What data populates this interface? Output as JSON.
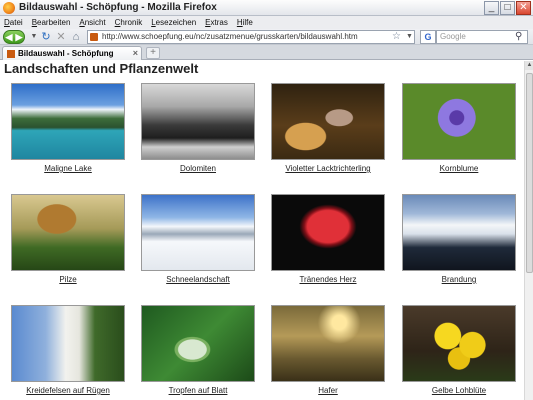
{
  "window": {
    "title": "Bildauswahl - Schöpfung - Mozilla Firefox",
    "controls": [
      "_",
      "□",
      "✕"
    ]
  },
  "menu": [
    "Datei",
    "Bearbeiten",
    "Ansicht",
    "Chronik",
    "Lesezeichen",
    "Extras",
    "Hilfe"
  ],
  "nav": {
    "url": "http://www.schoepfung.eu/nc/zusatzmenue/grusskarten/bildauswahl.htm",
    "search_placeholder": "Google",
    "search_engine_icon": "G"
  },
  "tab": {
    "label": "Bildauswahl - Schöpfung",
    "close": "×",
    "new_tab": "+"
  },
  "page": {
    "title": "Landschaften und Pflanzenwelt",
    "images": [
      {
        "caption": "Maligne Lake",
        "icon": "lake-landscape"
      },
      {
        "caption": "Dolomiten",
        "icon": "mountains"
      },
      {
        "caption": "Violetter Lacktrichterling",
        "icon": "mushroom"
      },
      {
        "caption": "Kornblume",
        "icon": "cornflower"
      },
      {
        "caption": "Pilze",
        "icon": "mushroom"
      },
      {
        "caption": "Schneelandschaft",
        "icon": "snow-mountains"
      },
      {
        "caption": "Tränendes Herz",
        "icon": "bleeding-heart-flower"
      },
      {
        "caption": "Brandung",
        "icon": "surf-waves"
      },
      {
        "caption": "Kreidefelsen auf Rügen",
        "icon": "chalk-cliffs"
      },
      {
        "caption": "Tropfen auf Blatt",
        "icon": "water-drop-leaf"
      },
      {
        "caption": "Hafer",
        "icon": "oats"
      },
      {
        "caption": "Gelbe Lohblüte",
        "icon": "yellow-slime-mold"
      }
    ]
  }
}
